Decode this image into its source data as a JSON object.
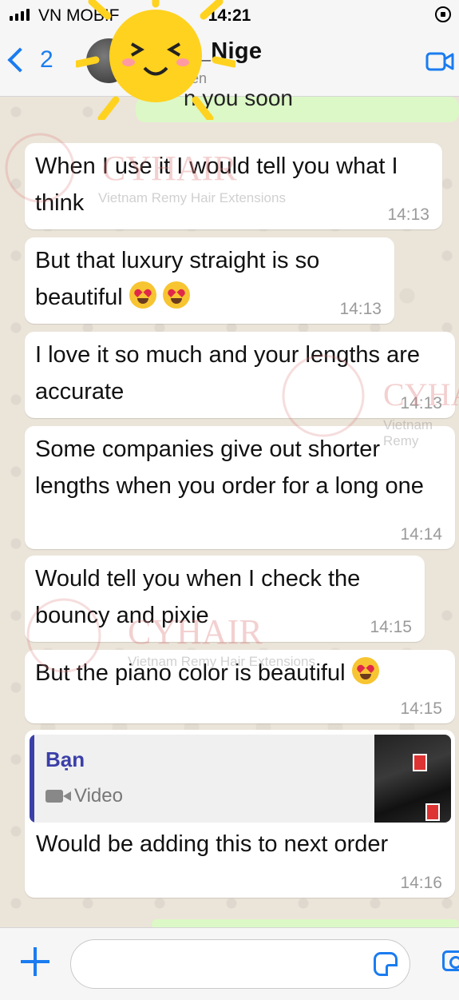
{
  "status_bar": {
    "carrier": "VN MOBIF",
    "time": "14:21"
  },
  "header": {
    "back_count": "2",
    "contact_name": "lda_Nige",
    "contact_status": "tuyến",
    "icons": [
      "chevron-left-icon",
      "video-call-icon"
    ]
  },
  "top_partial_message": "n you soon",
  "messages": [
    {
      "text": "When I use it I would tell you what I think",
      "time": "14:13"
    },
    {
      "text": "But that luxury straight is so beautiful",
      "time": "14:13",
      "emoji": "heart-eyes"
    },
    {
      "text": "I love it so much and your lengths are accurate",
      "time": "14:13"
    },
    {
      "text": "Some companies give out shorter lengths when you order for a long one",
      "time": "14:14"
    },
    {
      "text": "Would tell you when I check the bouncy and pixie",
      "time": "14:15"
    },
    {
      "text": "But the piano color is beautiful",
      "time": "14:15",
      "emoji": "heart-eyes"
    },
    {
      "quote": {
        "author": "Bạn",
        "type_label": "Video"
      },
      "text": "Would be adding this to next order",
      "time": "14:16"
    }
  ],
  "watermark": {
    "brand": "CYHAIR",
    "tagline": "Vietnam Remy Hair Extensions",
    "tagline_short": "Vietnam Remy"
  },
  "input": {
    "placeholder": "",
    "icons": [
      "plus-icon",
      "sticker-icon",
      "camera-icon"
    ]
  },
  "colors": {
    "accent": "#1a7cf0",
    "incoming_bubble": "#ffffff",
    "outgoing_bubble": "#dcf8c6",
    "quote_author": "#3b3fa8"
  }
}
